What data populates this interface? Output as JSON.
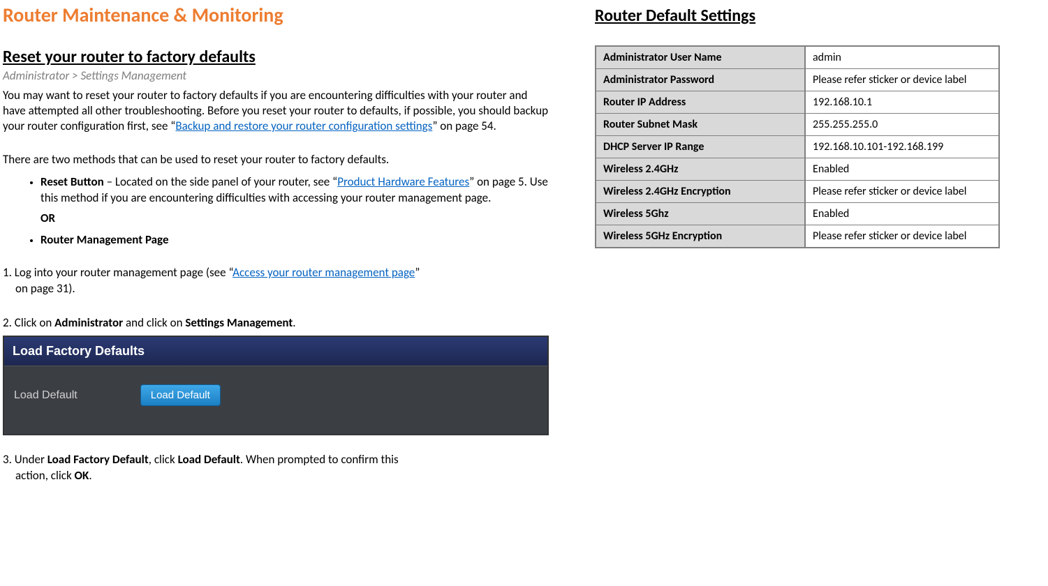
{
  "left": {
    "title": "Router Maintenance & Monitoring",
    "section_title": "Reset your router to factory defaults",
    "breadcrumb": "Administrator > Settings Management",
    "para1_a": "You may want to reset your router to factory defaults if you are encountering difficulties with your router and have attempted all other troubleshooting. Before you reset your router to defaults, if possible, you should backup your router configuration first, see “",
    "link1": "Backup and restore your router configuration settings",
    "para1_b": "” on page 54.",
    "para2": "There are two methods that can be used to reset your router to factory defaults.",
    "bullet1_a": "Reset Button",
    "bullet1_b": " – Located on the side panel of your router, see “",
    "bullet1_link": "Product Hardware Features",
    "bullet1_c": "” on page 5. Use this method if you are encountering difficulties with accessing your router management page.",
    "or": "OR",
    "bullet2": "Router Management Page",
    "step1_a": "1. Log into your router management page (see “",
    "step1_link": "Access your router management page",
    "step1_b": "”",
    "step1_c": "on page 31).",
    "step2_a": "2. Click on ",
    "step2_b": "Administrator",
    "step2_c": " and click on ",
    "step2_d": "Settings Management",
    "step2_e": ".",
    "ui_header": "Load Factory Defaults",
    "ui_label": "Load Default",
    "ui_button": "Load Default",
    "step3_a": "3. Under ",
    "step3_b": "Load Factory Default",
    "step3_c": ", click ",
    "step3_d": "Load Default",
    "step3_e": ". When prompted to confirm this",
    "step3_f": "action, click ",
    "step3_g": "OK",
    "step3_h": "."
  },
  "right": {
    "title": "Router Default Settings",
    "rows": [
      {
        "key": "Administrator User Name",
        "val": "admin"
      },
      {
        "key": "Administrator Password",
        "val": "Please refer sticker or device label"
      },
      {
        "key": "Router IP Address",
        "val": "192.168.10.1"
      },
      {
        "key": "Router Subnet Mask",
        "val": "255.255.255.0"
      },
      {
        "key": "DHCP Server IP Range",
        "val": "192.168.10.101-192.168.199"
      },
      {
        "key": "Wireless 2.4GHz",
        "val": "Enabled"
      },
      {
        "key": "Wireless 2.4GHz Encryption",
        "val": "Please refer sticker or device label"
      },
      {
        "key": "Wireless 5Ghz",
        "val": "Enabled"
      },
      {
        "key": "Wireless 5GHz Encryption",
        "val": "Please refer sticker or device label"
      }
    ]
  }
}
